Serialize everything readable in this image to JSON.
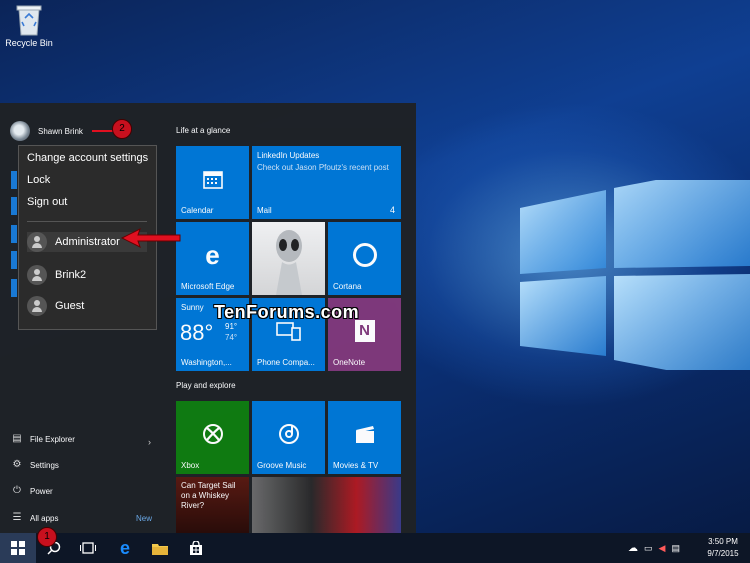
{
  "desktop": {
    "recycle_bin_label": "Recycle Bin"
  },
  "start_menu": {
    "user_name": "Shawn Brink",
    "account_menu": {
      "items": [
        "Change account settings",
        "Lock",
        "Sign out"
      ],
      "accounts": [
        "Administrator",
        "Brink2",
        "Guest"
      ]
    },
    "nav": {
      "file_explorer": "File Explorer",
      "settings": "Settings",
      "power": "Power",
      "all_apps": "All apps",
      "new_label": "New"
    },
    "groups": {
      "life": "Life at a glance",
      "play": "Play and explore"
    },
    "tiles": {
      "calendar": "Calendar",
      "mail": "Mail",
      "mail_count": "4",
      "mail_title": "LinkedIn Updates",
      "mail_body": "Check out Jason Pfoutz's recent post",
      "edge": "Microsoft Edge",
      "cortana": "Cortana",
      "weather_top": "Sunny",
      "weather_temp": "88°",
      "weather_hi": "91°",
      "weather_lo": "74°",
      "weather_city": "Washington,...",
      "phone": "Phone Compa...",
      "onenote": "OneNote",
      "xbox": "Xbox",
      "groove": "Groove Music",
      "movies": "Movies & TV",
      "news_headline": "Can Target Sail on a Whiskey River?"
    },
    "watermark": "TenForums.com"
  },
  "annotations": {
    "badge1": "1",
    "badge2": "2"
  },
  "taskbar": {
    "time": "3:50 PM",
    "date": "9/7/2015"
  },
  "colors": {
    "accent": "#0078d7",
    "xbox": "#107c10",
    "onenote": "#80397b",
    "annotation": "#e01020"
  }
}
